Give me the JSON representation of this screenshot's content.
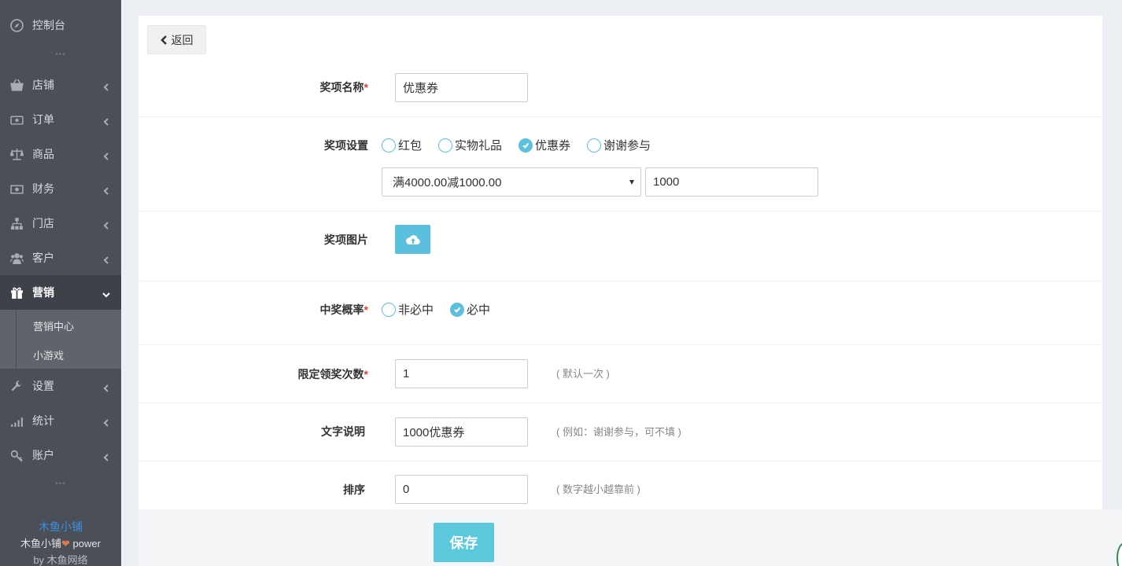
{
  "sidebar": {
    "dashboard": "控制台",
    "items": [
      {
        "label": "店铺",
        "icon": "basket-icon"
      },
      {
        "label": "订单",
        "icon": "cash-icon"
      },
      {
        "label": "商品",
        "icon": "scale-icon"
      },
      {
        "label": "财务",
        "icon": "money-icon"
      },
      {
        "label": "门店",
        "icon": "sitemap-icon"
      },
      {
        "label": "客户",
        "icon": "users-icon"
      },
      {
        "label": "营销",
        "icon": "gift-icon"
      },
      {
        "label": "设置",
        "icon": "wrench-icon"
      },
      {
        "label": "统计",
        "icon": "signal-icon"
      },
      {
        "label": "账户",
        "icon": "key-icon"
      }
    ],
    "submenu": [
      "营销中心",
      "小游戏"
    ],
    "brand": {
      "name": "木鱼小铺",
      "power_prefix": "木鱼小铺",
      "power_suffix": " power",
      "by_prefix": "by ",
      "by_name": "木鱼网络"
    }
  },
  "back_label": "返回",
  "form": {
    "name": {
      "label": "奖项名称",
      "value": "优惠券"
    },
    "setting": {
      "label": "奖项设置",
      "options": [
        "红包",
        "实物礼品",
        "优惠券",
        "谢谢参与"
      ],
      "selected": "优惠券",
      "coupon_select": "满4000.00减1000.00",
      "amount": "1000"
    },
    "image": {
      "label": "奖项图片"
    },
    "probability": {
      "label": "中奖概率",
      "options": [
        "非必中",
        "必中"
      ],
      "selected": "必中"
    },
    "limit": {
      "label": "限定领奖次数",
      "value": "1",
      "hint": "( 默认一次 )"
    },
    "text": {
      "label": "文字说明",
      "value": "1000优惠券",
      "hint": "( 例如：谢谢参与，可不填 )"
    },
    "sort": {
      "label": "排序",
      "value": "0",
      "hint": "( 数字越小越靠前 )"
    }
  },
  "save_label": "保存",
  "colors": {
    "sidebar_bg": "#4b5058",
    "accent": "#5bc0de",
    "required": "#e0403b",
    "brand_link": "#3b8fe0"
  }
}
